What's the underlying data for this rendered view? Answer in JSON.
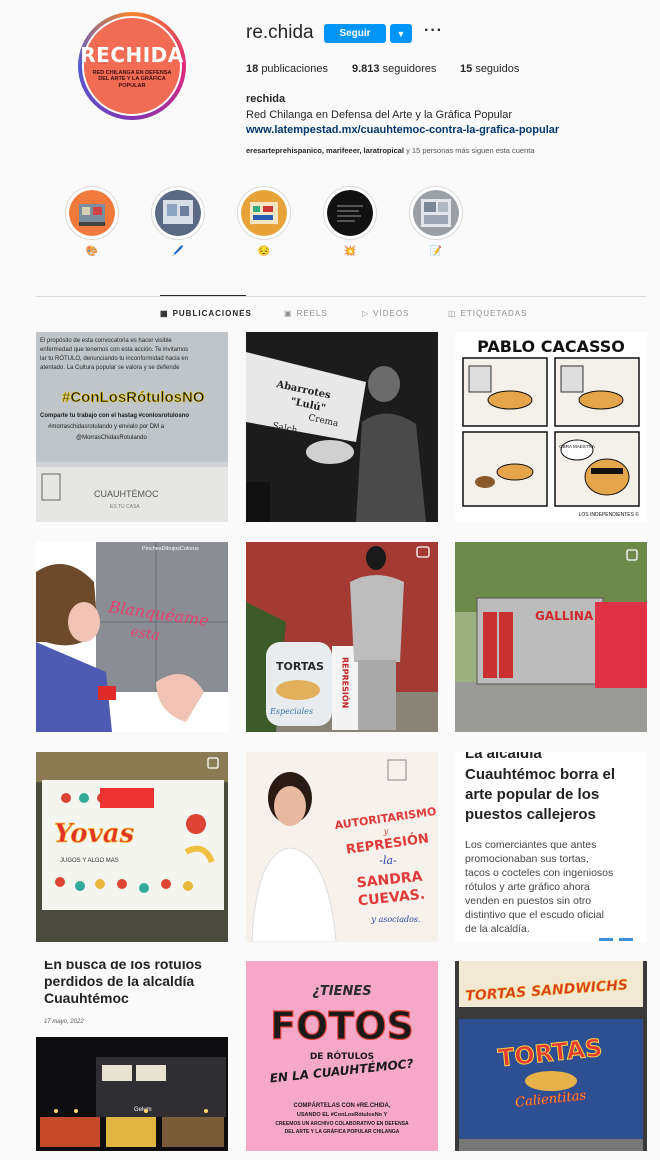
{
  "profile": {
    "username": "re.chida",
    "follow_label": "Seguir",
    "more_label": "···",
    "dropdown_icon": "chevron-down-icon",
    "avatar": {
      "big": "RECHIDA",
      "small": "RED CHILANGA EN DEFENSA DEL ARTE Y LA GRÁFICA POPULAR"
    },
    "stats": [
      {
        "value": "18",
        "label": "publicaciones"
      },
      {
        "value": "9.813",
        "label": "seguidores"
      },
      {
        "value": "15",
        "label": "seguidos"
      }
    ],
    "full_name": "rechida",
    "bio": "Red Chilanga en Defensa del Arte y la Gráfica Popular",
    "link": "www.latempestad.mx/cuauhtemoc-contra-la-grafica-popular",
    "followed_by_names": "eresarteprehispanico, marifeeer, laratropical",
    "followed_by_rest": " y 15 personas más siguen esta cuenta"
  },
  "highlights": [
    {
      "label": "🎨",
      "color": "#f07a3c"
    },
    {
      "label": "🖊️",
      "color": "#5a6a85"
    },
    {
      "label": "😔",
      "color": "#e8a23a"
    },
    {
      "label": "💥",
      "color": "#111111"
    },
    {
      "label": "📝",
      "color": "#9aa0a6"
    }
  ],
  "tabs": [
    {
      "label": "PUBLICACIONES",
      "icon": "grid-icon"
    },
    {
      "label": "REELS",
      "icon": "reels-icon"
    },
    {
      "label": "VÍDEOS",
      "icon": "video-icon"
    },
    {
      "label": "ETIQUETADAS",
      "icon": "tagged-icon"
    }
  ],
  "posts": {
    "p1": {
      "text1": "El propósito de esta convocatoria es hacer visible",
      "text2": "enfermedad que tenemos con esta acción. Te invitamos",
      "text3": "lar tu RÓTULO, denunciando tu inconformidad hacia en",
      "text4": "atentado. La Cultura popular se valora y se defiende",
      "hashtag": "#ConLosRótulosNO",
      "line5": "Comparte tu trabajo con el hastag #conlosrotulosno",
      "line6": "#morraschidasrotulando y envialo por DM a",
      "line7": "@MorrasChidasRotulando",
      "footer": "CUAUHTÉMOC",
      "footer_sub": "ES TU CASA"
    },
    "p2": {
      "sign1": "Abarrotes",
      "sign2": "\"Lulú\"",
      "sign3": "Crema",
      "sign4": "Salch"
    },
    "p3": {
      "title": "PABLO CACASSO",
      "bubble": "OBRA MAESTRA",
      "credit": "LOS INDEPENDIENTES ©"
    },
    "p4": {
      "tag": "PinchesDibujosColorus",
      "text1": "Blanquéame",
      "text2": "esta"
    },
    "p5": {
      "sign1": "TORTAS",
      "sign2": "Especiales",
      "sign3": "REPRESIÓN"
    },
    "p6": {
      "sign": "GALLINA"
    },
    "p7": {
      "sign": "Yovas",
      "sub": "JUGOS Y ALGO MAS"
    },
    "p8": {
      "l1": "AUTORITARISMO",
      "l2": "y",
      "l3": "REPRESIÓN",
      "l4": "-la-",
      "l5": "SANDRA",
      "l6": "CUEVAS.",
      "l7": "y asociados."
    },
    "p9": {
      "title1": "La alcaldía",
      "title2": "Cuauhtémoc borra el",
      "title3": "arte popular de los",
      "title4": "puestos callejeros",
      "body1": "Los comerciantes que antes",
      "body2": "promocionaban sus tortas,",
      "body3": "tacos o cocteles con ingeniosos",
      "body4": "rótulos y arte gráfico ahora",
      "body5": "venden en puestos sin otro",
      "body6": "distintivo que el escudo oficial",
      "body7": "de la alcaldía."
    },
    "p10": {
      "title1": "En busca de los rótulos",
      "title2": "perdidos de la alcaldía",
      "title3": "Cuauhtémoc",
      "date": "17 mayo, 2022",
      "sign": "Gelum"
    },
    "p11": {
      "l1": "¿TIENES",
      "l2": "FOTOS",
      "l3": "DE RÓTULOS",
      "l4": "EN LA CUAUHTÉMOC?",
      "l5": "COMPÁRTELAS CON #RE.CHIDA,",
      "l6": "USANDO EL #ConLosRótulosNo Y",
      "l7": "CREEMOS UN ARCHIVO COLABORATIVO EN DEFENSA",
      "l8": "DEL ARTE Y LA GRÁFICA POPULAR CHILANGA"
    },
    "p12": {
      "sign1": "TORTAS SANDWICHS",
      "sign2": "TORTAS",
      "sign3": "Calientitas"
    }
  },
  "colors": {
    "accent": "#0095f6",
    "link": "#00376b",
    "avatar": "#f26b54"
  }
}
